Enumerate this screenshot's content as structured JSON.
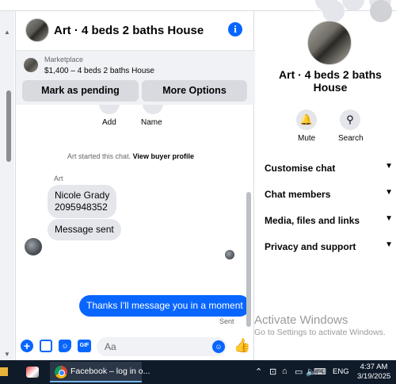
{
  "chat": {
    "title": "Art · 4 beds 2 baths House",
    "listing": {
      "source": "Marketplace",
      "price_title": "$1,400 – 4 beds 2 baths House",
      "pending_button": "Mark as pending",
      "options_button": "More Options"
    },
    "actions": {
      "add_label": "Add",
      "name_label": "Name"
    },
    "started_text": "Art started this chat.",
    "buyer_profile_link": "View buyer profile",
    "sender_name": "Art",
    "incoming": [
      {
        "line1": "Nicole Grady",
        "line2": "2095948352"
      },
      {
        "line1": "Message sent",
        "line2": ""
      }
    ],
    "outgoing": "Thanks I'll message you in a moment",
    "sent_status": "Sent",
    "composer": {
      "placeholder": "Aa",
      "gif_label": "GIF"
    }
  },
  "info_panel": {
    "title": "Art · 4 beds 2 baths House",
    "mute_label": "Mute",
    "search_label": "Search",
    "sections": [
      "Customise chat",
      "Chat members",
      "Media, files and links",
      "Privacy and support"
    ]
  },
  "watermark": {
    "line1": "Activate Windows",
    "line2": "Go to Settings to activate Windows."
  },
  "taskbar": {
    "task_label": "Facebook – log in o...",
    "language": "ENG",
    "time": "4:37 AM",
    "date": "3/19/2025"
  },
  "colors": {
    "accent": "#0866ff",
    "bubble_in": "#e4e6eb",
    "taskbar": "#101b2a"
  }
}
